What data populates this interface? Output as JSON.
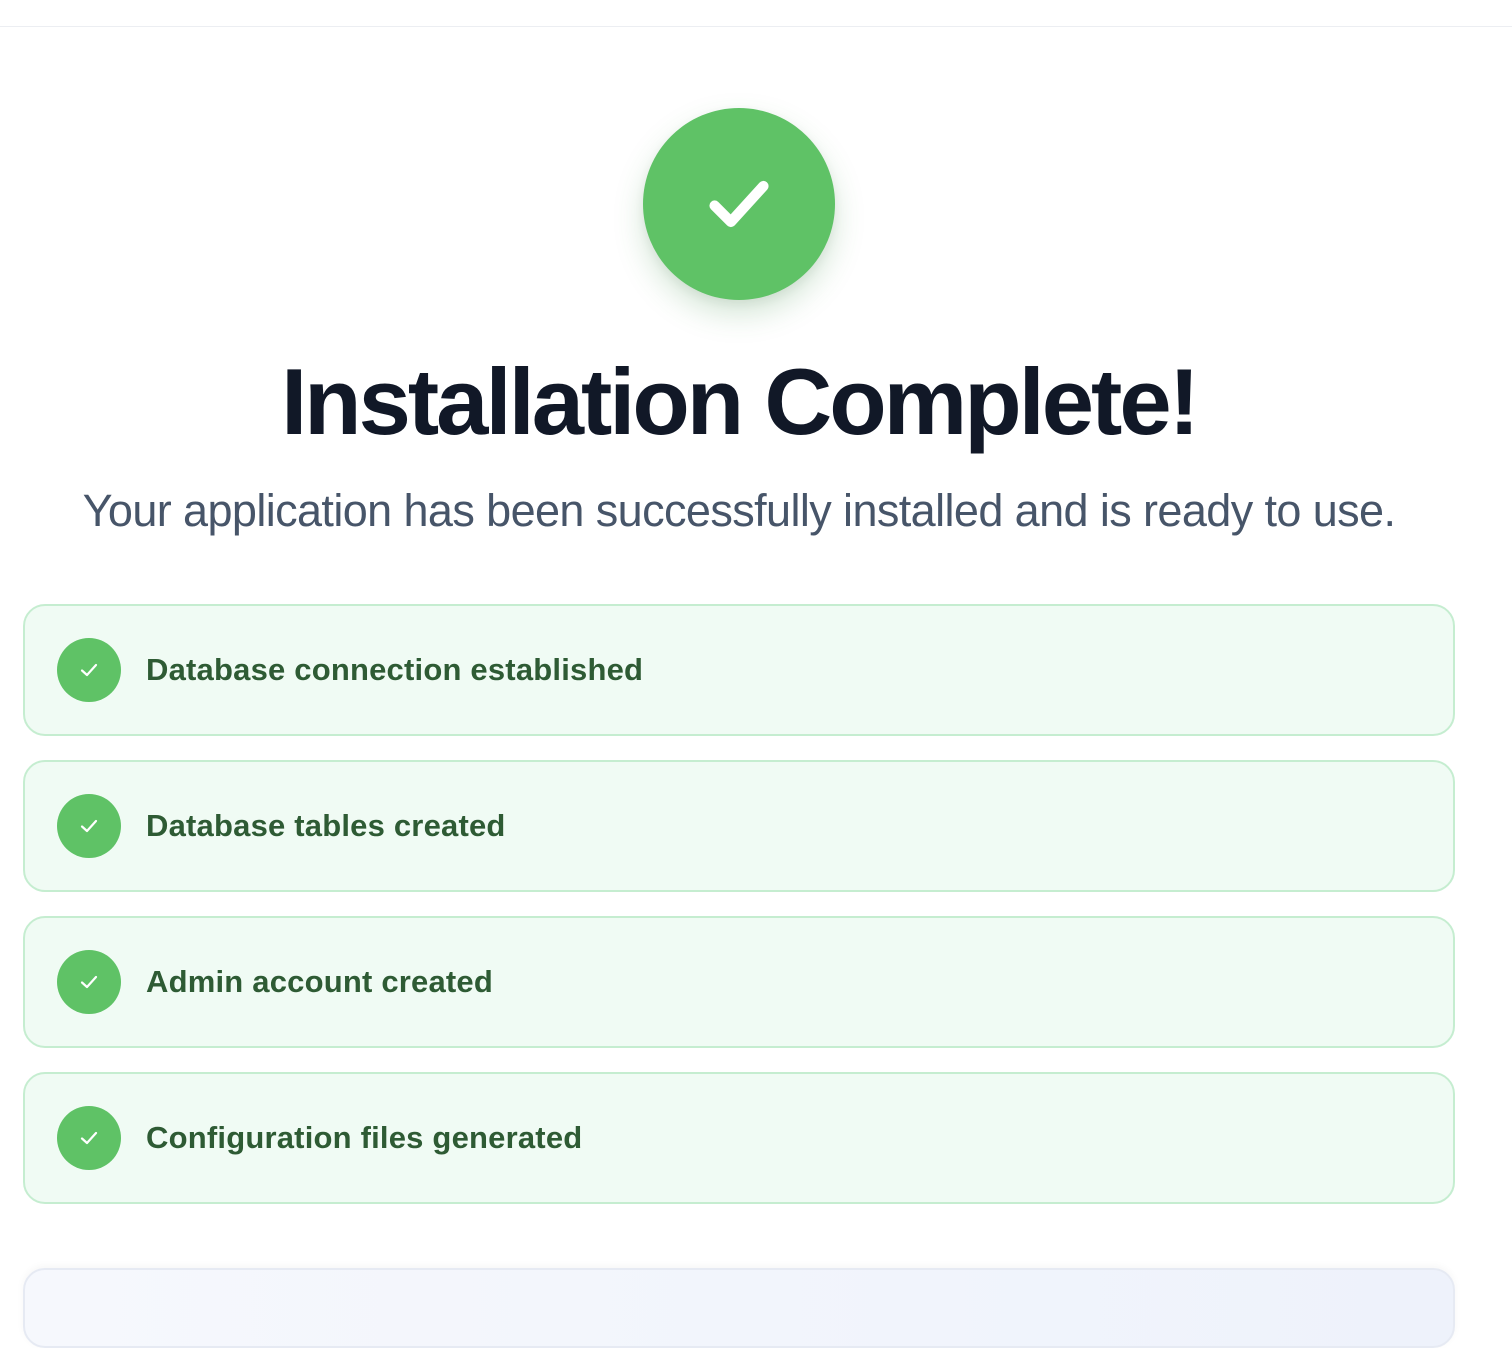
{
  "header": {
    "icon": "check-circle-icon",
    "title": "Installation Complete!",
    "subtitle": "Your application has been successfully installed and is ready to use."
  },
  "steps": [
    {
      "label": "Database connection established",
      "icon": "check-icon",
      "status": "complete"
    },
    {
      "label": "Database tables created",
      "icon": "check-icon",
      "status": "complete"
    },
    {
      "label": "Admin account created",
      "icon": "check-icon",
      "status": "complete"
    },
    {
      "label": "Configuration files generated",
      "icon": "check-icon",
      "status": "complete"
    }
  ],
  "colors": {
    "success": "#5fc266",
    "step_background": "#f0fbf4",
    "step_border": "#c5edd0",
    "step_text": "#2e5b34",
    "title": "#111827",
    "subtitle": "#475569"
  }
}
